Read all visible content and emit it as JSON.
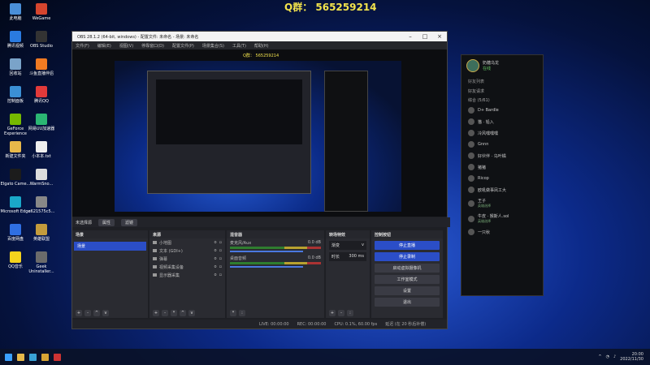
{
  "overlay_text": "Q群： 565259214",
  "desktop_icons": [
    {
      "label": "此电脑",
      "color": "#4a8fd8"
    },
    {
      "label": "WeGame",
      "color": "#d5452e"
    },
    {
      "label": "腾讯视频",
      "color": "#2a7be0"
    },
    {
      "label": "OBS Studio",
      "color": "#333"
    },
    {
      "label": "回收站",
      "color": "#7aa3c9"
    },
    {
      "label": "斗鱼直播伴侣",
      "color": "#f07a22"
    },
    {
      "label": "控制面板",
      "color": "#3b8fd4"
    },
    {
      "label": "腾讯QQ",
      "color": "#e23a3a"
    },
    {
      "label": "GeForce Experience",
      "color": "#76b900"
    },
    {
      "label": "网易UU加速器",
      "color": "#2bb673"
    },
    {
      "label": "新建文件夹",
      "color": "#e8b84a"
    },
    {
      "label": "小本本.txt",
      "color": "#eee"
    },
    {
      "label": "Elgato Came...",
      "color": "#1c1c1c"
    },
    {
      "label": "WarmSno...",
      "color": "#ddd"
    },
    {
      "label": "Microsoft Edge",
      "color": "#1aa8c9"
    },
    {
      "label": "e621575c5...",
      "color": "#888"
    },
    {
      "label": "百度网盘",
      "color": "#2f6fe3"
    },
    {
      "label": "英雄联盟",
      "color": "#c39b3c"
    },
    {
      "label": "QQ音乐",
      "color": "#f4d21d"
    },
    {
      "label": "Geek Uninstaller...",
      "color": "#6b6b6b"
    }
  ],
  "obs": {
    "title": "OBS 28.1.2 (64-bit, windows) - 配置文件: 未命名 - 场景: 未命名",
    "menu": [
      "文件(F)",
      "编辑(E)",
      "视图(V)",
      "停靠窗口(D)",
      "配置文件(P)",
      "场景集合(S)",
      "工具(T)",
      "帮助(H)"
    ],
    "status_strip": {
      "label": "未选择源",
      "props": "属性",
      "filters": "滤镜"
    },
    "scenes": {
      "title": "场景",
      "items": [
        "场景"
      ]
    },
    "sources": {
      "title": "来源",
      "items": [
        "小地图",
        "文本 (GDI+)",
        "弹幕",
        "视频采集设备",
        "显示器采集"
      ]
    },
    "mixer": {
      "title": "混音器",
      "channels": [
        {
          "name": "麦克风/Aux",
          "level": "0.0 dB"
        },
        {
          "name": "桌面音频",
          "level": "0.0 dB"
        }
      ]
    },
    "transitions": {
      "title": "转场特效",
      "mode": "渐变",
      "duration_label": "时长",
      "duration": "300 ms"
    },
    "controls": {
      "title": "控制按钮",
      "buttons": [
        "停止直播",
        "停止录制",
        "启动虚拟摄像机",
        "工作室模式",
        "设置",
        "退出"
      ]
    },
    "statusbar": {
      "live": "LIVE: 00:00:00",
      "rec": "REC: 00:00:00",
      "cpu": "CPU: 0.1%, 60.00 fps",
      "drop": "延迟 (在 20 秒后补偿)"
    }
  },
  "chat": {
    "name": "奶糖乌龙",
    "status": "在线",
    "tab": "好友列表",
    "group": "综合 (5/61)",
    "favorites": "好友请求",
    "friends": [
      {
        "name": "D+ Bardle",
        "sub": ""
      },
      {
        "name": "猫 · 铅入",
        "sub": ""
      },
      {
        "name": "冷风嘿嘿嘿",
        "sub": ""
      },
      {
        "name": "Gnnn",
        "sub": ""
      },
      {
        "name": "好伙伴 · 乌叶橘",
        "sub": ""
      },
      {
        "name": "猪猪",
        "sub": ""
      },
      {
        "name": "Ricop",
        "sub": ""
      },
      {
        "name": "欧吼做事凤工大",
        "sub": ""
      },
      {
        "name": "王子",
        "sub": "英雄选择"
      },
      {
        "name": "牛皮 · 猴斯人.sol",
        "sub": "英雄选择"
      },
      {
        "name": "一只秋",
        "sub": ""
      }
    ]
  },
  "taskbar": {
    "time": "20:00",
    "date": "2022/11/30"
  }
}
